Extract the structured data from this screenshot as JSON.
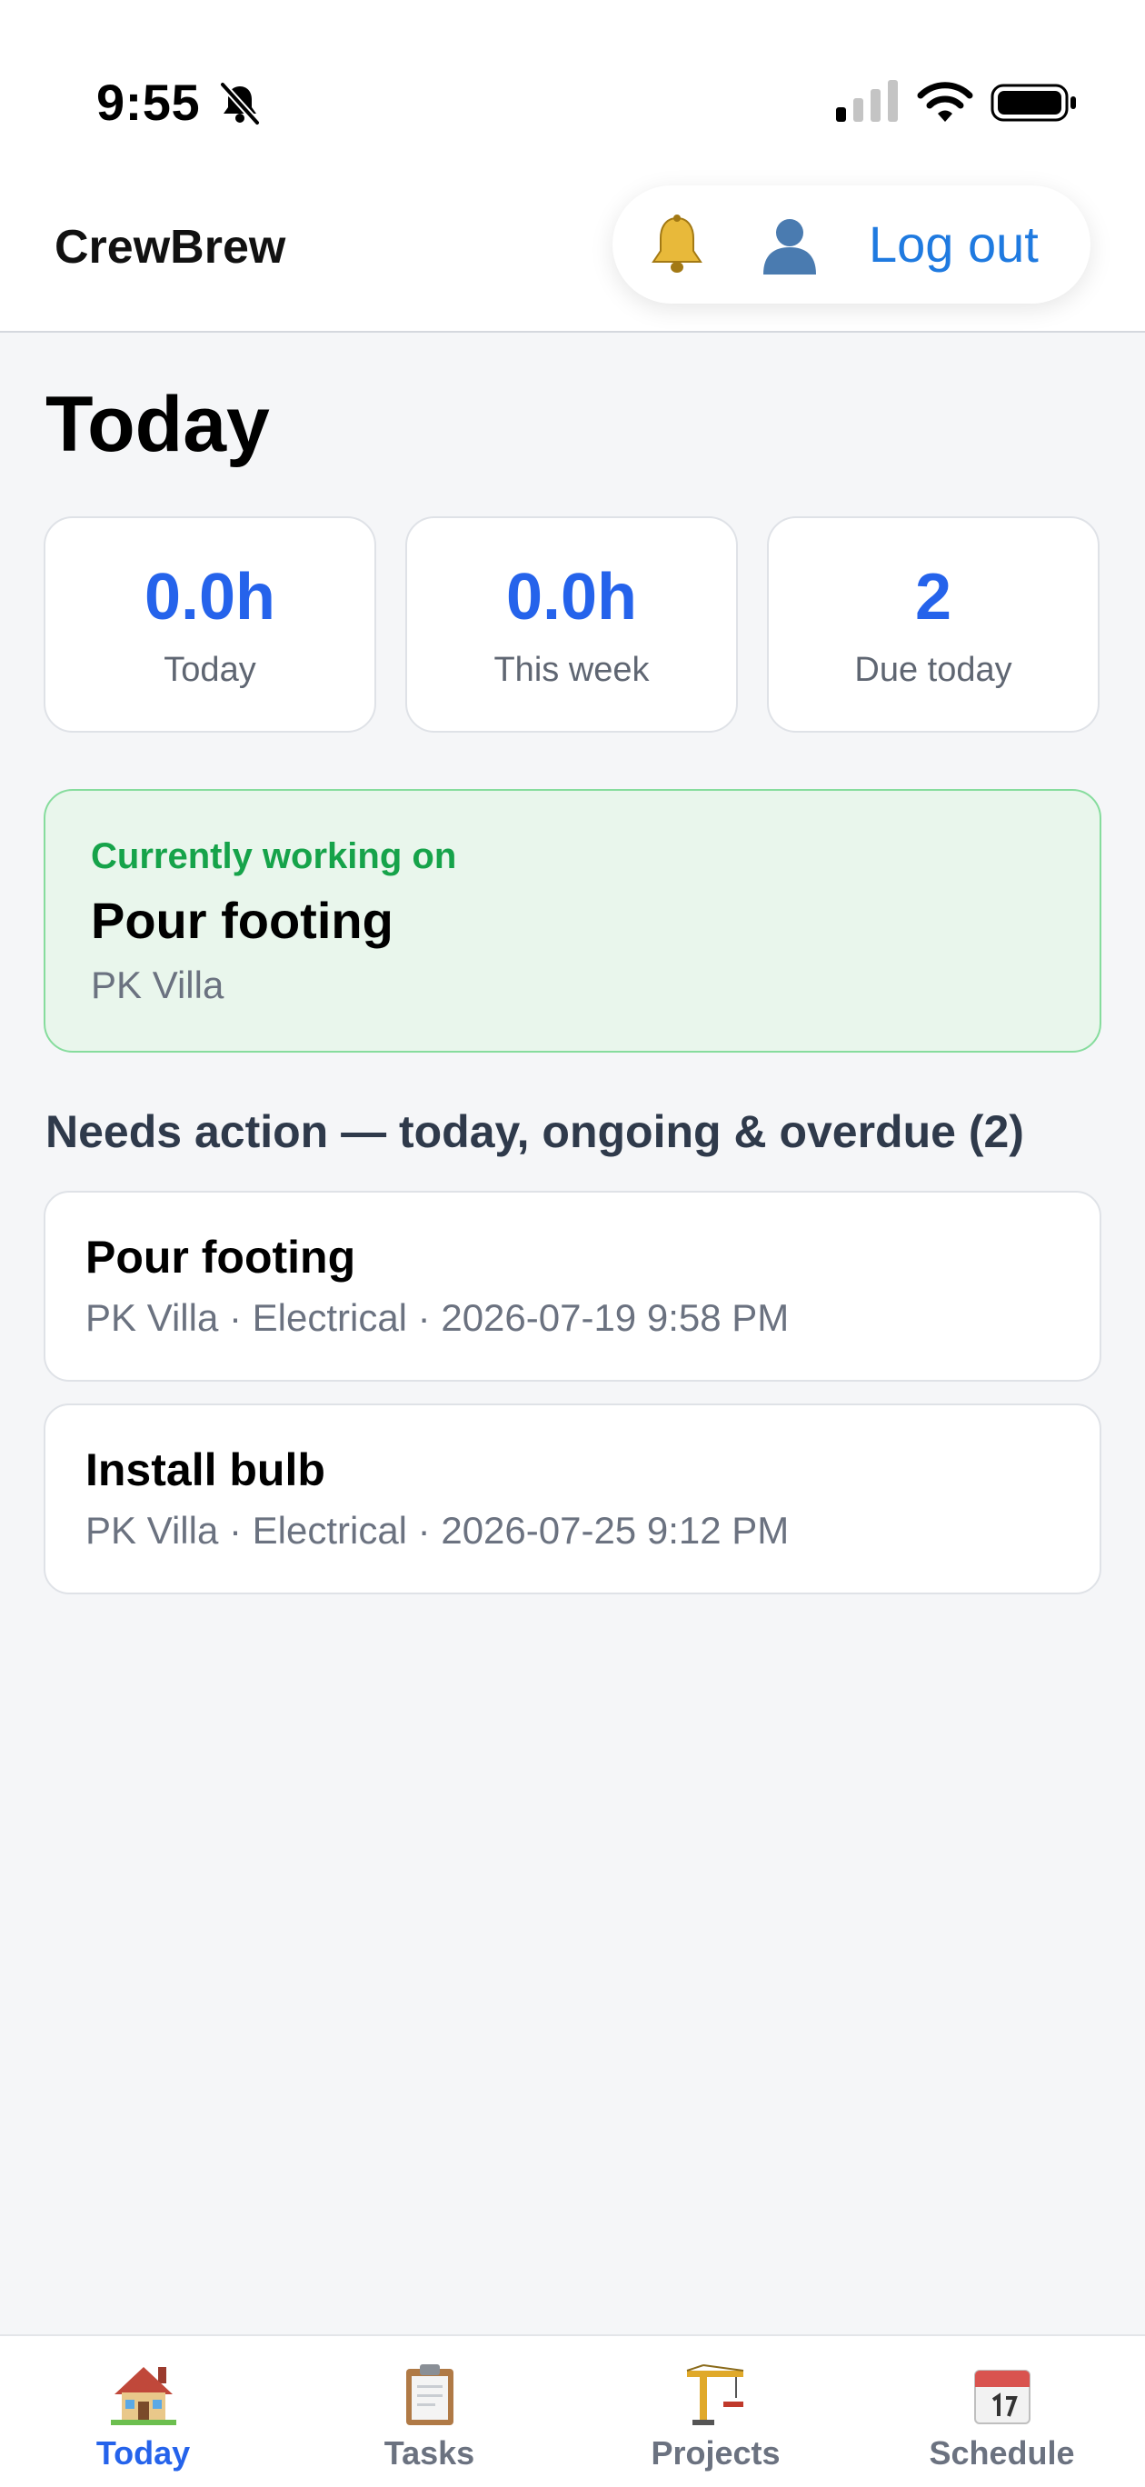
{
  "status_bar": {
    "time": "9:55",
    "icons": [
      "bell-slash-icon",
      "cellular-signal-icon",
      "wifi-icon",
      "battery-icon"
    ]
  },
  "header": {
    "brand": "CrewBrew",
    "notification_icon": "bell-icon",
    "profile_icon": "user-icon",
    "logout_label": "Log out"
  },
  "page": {
    "title": "Today"
  },
  "stats": [
    {
      "value": "0.0h",
      "label": "Today"
    },
    {
      "value": "0.0h",
      "label": "This week"
    },
    {
      "value": "2",
      "label": "Due today"
    }
  ],
  "current": {
    "kicker": "Currently working on",
    "title": "Pour footing",
    "project": "PK Villa"
  },
  "needs_action": {
    "heading": "Needs action — today, ongoing & overdue (2)",
    "tasks": [
      {
        "title": "Pour footing",
        "meta": "PK Villa · Electrical · 2026-07-19 9:58 PM"
      },
      {
        "title": "Install bulb",
        "meta": "PK Villa · Electrical · 2026-07-25 9:12 PM"
      }
    ]
  },
  "tabbar": {
    "active": "Today",
    "tabs": [
      {
        "label": "Today",
        "icon": "house-icon"
      },
      {
        "label": "Tasks",
        "icon": "clipboard-icon"
      },
      {
        "label": "Projects",
        "icon": "crane-icon"
      },
      {
        "label": "Schedule",
        "icon": "calendar-icon"
      }
    ]
  },
  "colors": {
    "accent": "#2563eb",
    "link": "#1f7ae0",
    "success": "#16a34a",
    "success_bg": "#e9f6ec",
    "muted": "#6b7280",
    "background": "#f5f6f8"
  }
}
